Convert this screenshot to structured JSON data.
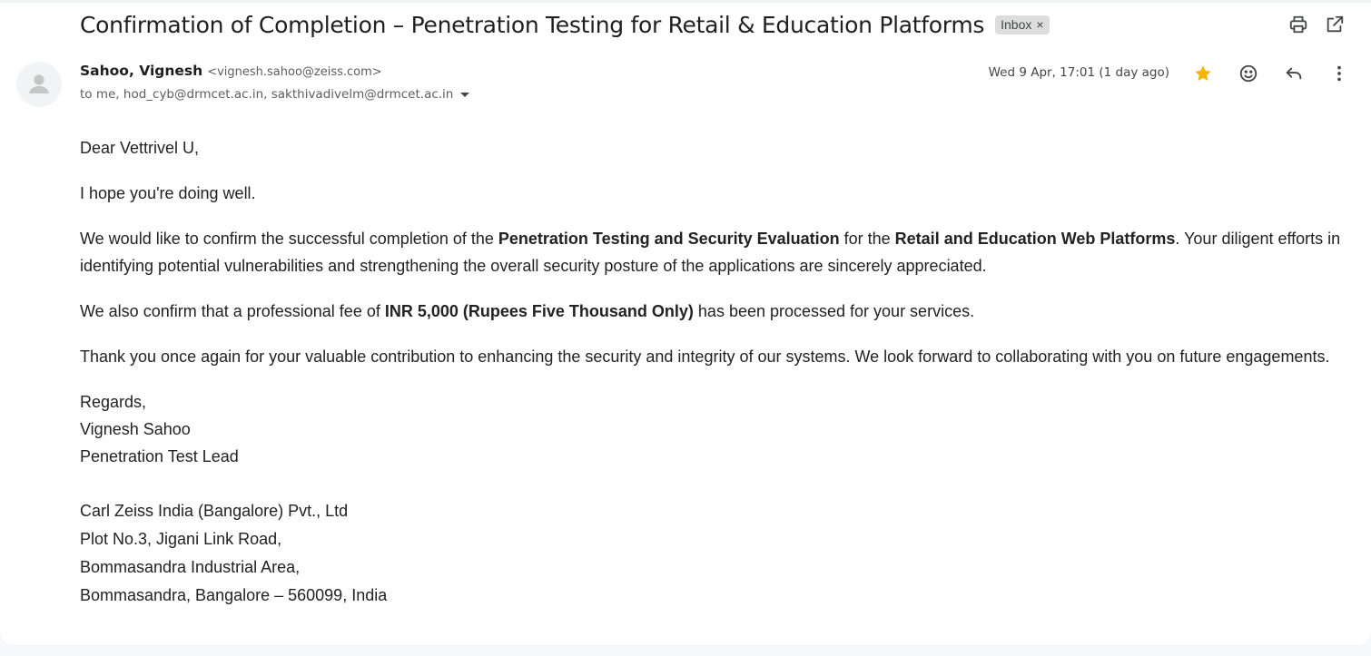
{
  "email": {
    "subject": "Confirmation of Completion – Penetration Testing for Retail & Education Platforms",
    "label": "Inbox",
    "label_remove": "×",
    "sender_name": "Sahoo, Vignesh",
    "sender_email": "<vignesh.sahoo@zeiss.com>",
    "recipients": "to me, hod_cyb@drmcet.ac.in, sakthivadivelm@drmcet.ac.in",
    "date": "Wed 9 Apr, 17:01 (1 day ago)",
    "starred": true,
    "colors": {
      "star": "#f5b400",
      "chip_bg": "#dddddd"
    }
  },
  "toolbar": {
    "icons": [
      "print-icon",
      "open-in-new-window-icon"
    ],
    "message_icons": [
      "star-icon",
      "emoji-reaction-icon",
      "reply-icon",
      "more-vert-icon"
    ]
  },
  "body": {
    "greeting": "Dear Vettrivel U,",
    "p1": "I hope you're doing well.",
    "p2_a": "We would like to confirm the successful completion of the ",
    "p2_b": "Penetration Testing and Security Evaluation",
    "p2_c": " for the ",
    "p2_d": "Retail and Education Web Platforms",
    "p2_e": ". Your diligent efforts in identifying potential vulnerabilities and strengthening the overall security posture of the applications are sincerely appreciated.",
    "p3_a": "We also confirm that a professional fee of ",
    "p3_b": "INR 5,000 (Rupees Five Thousand Only)",
    "p3_c": " has been processed for your services.",
    "p4": "Thank you once again for your valuable contribution to enhancing the security and integrity of our systems. We look forward to collaborating with you on future engagements.",
    "closing": "Regards,",
    "sig_name": "Vignesh Sahoo",
    "sig_title": "Penetration Test Lead",
    "address": [
      "Carl Zeiss India (Bangalore) Pvt., Ltd",
      "Plot No.3, Jigani Link Road,",
      "Bommasandra Industrial Area,",
      "Bommasandra, Bangalore – 560099, India"
    ]
  }
}
